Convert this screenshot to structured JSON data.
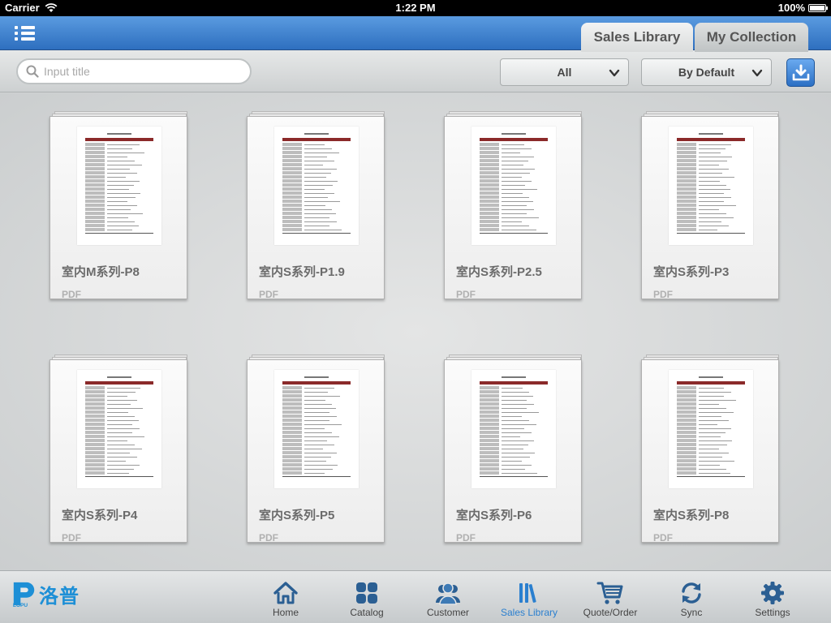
{
  "status_bar": {
    "carrier": "Carrier",
    "time": "1:22 PM",
    "battery": "100%"
  },
  "nav": {
    "tabs": [
      {
        "label": "Sales Library",
        "active": true
      },
      {
        "label": "My Collection",
        "active": false
      }
    ]
  },
  "toolbar": {
    "search_placeholder": "Input title",
    "filter_value": "All",
    "sort_value": "By Default"
  },
  "documents": [
    {
      "title": "室内M系列-P8",
      "type": "PDF"
    },
    {
      "title": "室内S系列-P1.9",
      "type": "PDF"
    },
    {
      "title": "室内S系列-P2.5",
      "type": "PDF"
    },
    {
      "title": "室内S系列-P3",
      "type": "PDF"
    },
    {
      "title": "室内S系列-P4",
      "type": "PDF"
    },
    {
      "title": "室内S系列-P5",
      "type": "PDF"
    },
    {
      "title": "室内S系列-P6",
      "type": "PDF"
    },
    {
      "title": "室内S系列-P8",
      "type": "PDF"
    }
  ],
  "brand": {
    "name": "洛普",
    "mark_text": "LOPU",
    "color": "#1d8fd6"
  },
  "tabbar": {
    "items": [
      {
        "label": "Home",
        "icon": "home-icon"
      },
      {
        "label": "Catalog",
        "icon": "catalog-icon"
      },
      {
        "label": "Customer",
        "icon": "customer-icon"
      },
      {
        "label": "Sales Library",
        "icon": "sales-library-icon",
        "active": true
      },
      {
        "label": "Quote/Order",
        "icon": "cart-icon"
      },
      {
        "label": "Sync",
        "icon": "sync-icon"
      },
      {
        "label": "Settings",
        "icon": "gear-icon"
      }
    ]
  },
  "colors": {
    "nav_blue": "#3a7fd0",
    "active_tab_label": "#2a7fcf",
    "doc_header_red": "#8b2a2a"
  }
}
